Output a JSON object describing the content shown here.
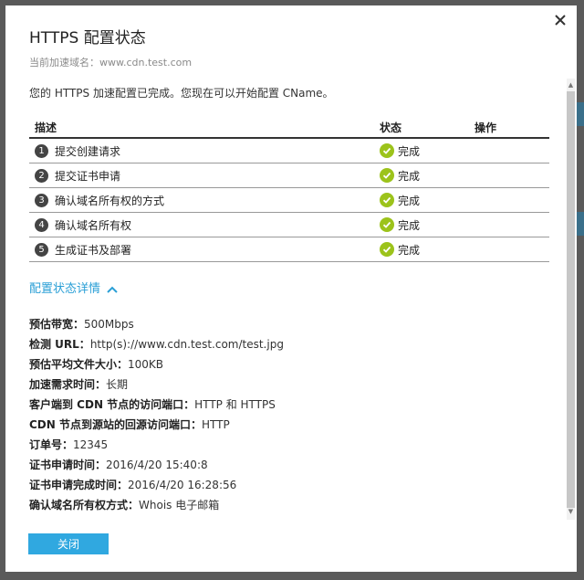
{
  "dialog": {
    "title": "HTTPS 配置状态",
    "subtitle": "当前加速域名：www.cdn.test.com",
    "message": "您的 HTTPS 加速配置已完成。您现在可以开始配置 CName。",
    "close_button_label": "关闭"
  },
  "table": {
    "headers": {
      "desc": "描述",
      "status": "状态",
      "action": "操作"
    },
    "rows": [
      {
        "num": "1",
        "desc": "提交创建请求",
        "status": "完成"
      },
      {
        "num": "2",
        "desc": "提交证书申请",
        "status": "完成"
      },
      {
        "num": "3",
        "desc": "确认域名所有权的方式",
        "status": "完成"
      },
      {
        "num": "4",
        "desc": "确认域名所有权",
        "status": "完成"
      },
      {
        "num": "5",
        "desc": "生成证书及部署",
        "status": "完成"
      }
    ]
  },
  "details": {
    "toggle_label": "配置状态详情",
    "items": [
      {
        "label": "预估带宽：",
        "value": "500Mbps"
      },
      {
        "label": "检测 URL：",
        "value": "http(s)://www.cdn.test.com/test.jpg"
      },
      {
        "label": "预估平均文件大小：",
        "value": "100KB"
      },
      {
        "label": "加速需求时间：",
        "value": "长期"
      },
      {
        "label": "客户端到 CDN 节点的访问端口：",
        "value": "HTTP 和 HTTPS"
      },
      {
        "label": "CDN 节点到源站的回源访问端口：",
        "value": "HTTP"
      },
      {
        "label": "订单号：",
        "value": "12345"
      },
      {
        "label": "证书申请时间：",
        "value": "2016/4/20 15:40:8"
      },
      {
        "label": "证书申请完成时间：",
        "value": "2016/4/20 16:28:56"
      },
      {
        "label": "确认域名所有权方式：",
        "value": "Whois 电子邮箱"
      }
    ]
  },
  "colors": {
    "accent": "#30a8e0",
    "link": "#2a9fd6",
    "success": "#9cc31b"
  },
  "icons": {
    "close": "close-icon",
    "check": "check-circle-icon",
    "toggle": "chevron-up-icon"
  }
}
